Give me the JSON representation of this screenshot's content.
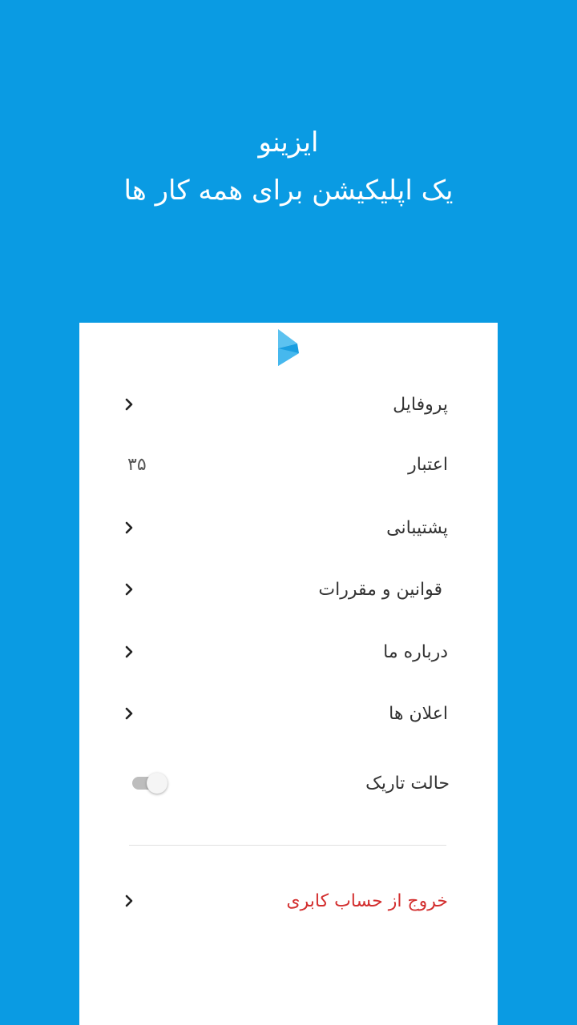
{
  "header": {
    "app_name": "ایزینو",
    "tagline": "یک اپلیکیشن برای همه کار ها"
  },
  "colors": {
    "background": "#0a9be3",
    "panel": "#ffffff",
    "logout_text": "#d32f2f",
    "logo": "#29a9e8"
  },
  "logo": {
    "icon": "play-triangle-logo"
  },
  "menu": {
    "profile": "پروفایل",
    "credit": "اعتبار",
    "credit_value": "۳۵",
    "support": "پشتیبانی",
    "terms": "قوانین و مقررات",
    "about": "درباره ما",
    "notifications": "اعلان ها",
    "dark_mode": "حالت تاریک",
    "dark_mode_on": false,
    "logout": "خروج از حساب کابری"
  }
}
